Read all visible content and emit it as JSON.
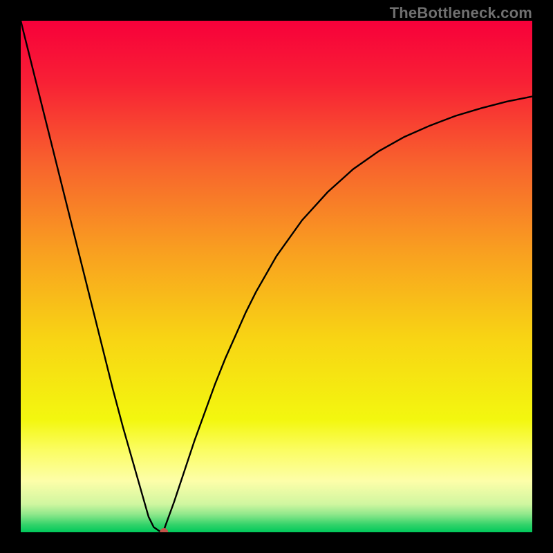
{
  "watermark": "TheBottleneck.com",
  "chart_data": {
    "type": "line",
    "title": "",
    "xlabel": "",
    "ylabel": "",
    "xlim": [
      0,
      100
    ],
    "ylim": [
      0,
      100
    ],
    "grid": false,
    "series": [
      {
        "name": "curve",
        "x": [
          0,
          2,
          4,
          6,
          8,
          10,
          12,
          14,
          16,
          18,
          20,
          22,
          24,
          25,
          26,
          27,
          27.5,
          28,
          30,
          32,
          34,
          36,
          38,
          40,
          42,
          44,
          46,
          48,
          50,
          55,
          60,
          65,
          70,
          75,
          80,
          85,
          90,
          95,
          100
        ],
        "values": [
          100,
          92.0,
          84.0,
          76.0,
          68.0,
          60.0,
          52.0,
          44.0,
          36.0,
          28.0,
          20.5,
          13.5,
          6.5,
          3.0,
          1.0,
          0.3,
          0.0,
          0.5,
          6.0,
          12.0,
          18.0,
          23.5,
          29.0,
          34.0,
          38.5,
          43.0,
          47.0,
          50.5,
          54.0,
          61.0,
          66.5,
          71.0,
          74.5,
          77.3,
          79.5,
          81.4,
          82.9,
          84.2,
          85.2
        ]
      }
    ],
    "marker": {
      "x": 28.0,
      "y": 0.0,
      "color": "#c4544a"
    },
    "background_gradient": {
      "stops": [
        {
          "pos": 0.0,
          "color": "#f7003a"
        },
        {
          "pos": 0.12,
          "color": "#f82035"
        },
        {
          "pos": 0.28,
          "color": "#f8632d"
        },
        {
          "pos": 0.45,
          "color": "#f99f20"
        },
        {
          "pos": 0.62,
          "color": "#f8d414"
        },
        {
          "pos": 0.78,
          "color": "#f3f70f"
        },
        {
          "pos": 0.84,
          "color": "#fbfd63"
        },
        {
          "pos": 0.9,
          "color": "#fdfea9"
        },
        {
          "pos": 0.945,
          "color": "#d0f6a0"
        },
        {
          "pos": 0.965,
          "color": "#8fe88b"
        },
        {
          "pos": 0.985,
          "color": "#33d36a"
        },
        {
          "pos": 1.0,
          "color": "#00c95b"
        }
      ]
    }
  }
}
